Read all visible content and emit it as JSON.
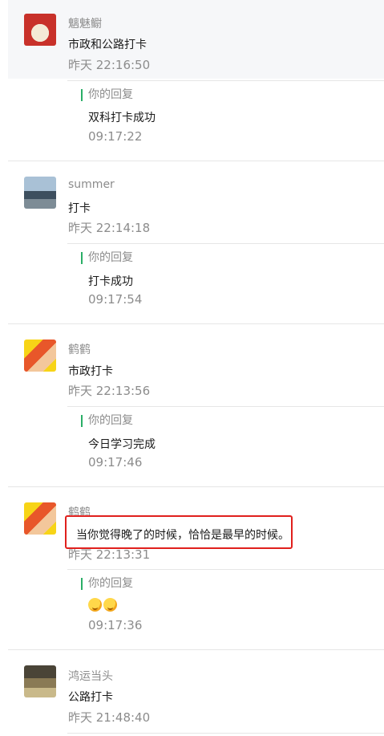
{
  "comments": [
    {
      "avatar": "apple-photo",
      "name": "魑魅鳚",
      "content": "市政和公路打卡",
      "time": "昨天 22:16:50",
      "reply_label": "你的回复",
      "reply_text": "双科打卡成功",
      "reply_time": "09:17:22"
    },
    {
      "avatar": "city-skyline-photo",
      "name": "summer",
      "content": "打卡",
      "time": "昨天 22:14:18",
      "reply_label": "你的回复",
      "reply_text": "打卡成功",
      "reply_time": "09:17:54"
    },
    {
      "avatar": "child-photo",
      "name": "鹤鹤",
      "content": "市政打卡",
      "time": "昨天 22:13:56",
      "reply_label": "你的回复",
      "reply_text": "今日学习完成",
      "reply_time": "09:17:46"
    },
    {
      "avatar": "child-photo",
      "name": "鹤鹤",
      "content": "当你觉得晚了的时候，恰恰是最早的时候。",
      "time": "昨天 22:13:31",
      "reply_label": "你的回复",
      "reply_emoji": [
        "hug-emoji",
        "hug-emoji"
      ],
      "reply_time": "09:17:36"
    },
    {
      "avatar": "outdoor-photo",
      "name": "鸿运当头",
      "content": "公路打卡",
      "time": "昨天 21:48:40"
    }
  ],
  "colors": {
    "reply_accent": "#2aae67",
    "highlight_border": "#e0201d",
    "muted_text": "#8c8c8c"
  }
}
